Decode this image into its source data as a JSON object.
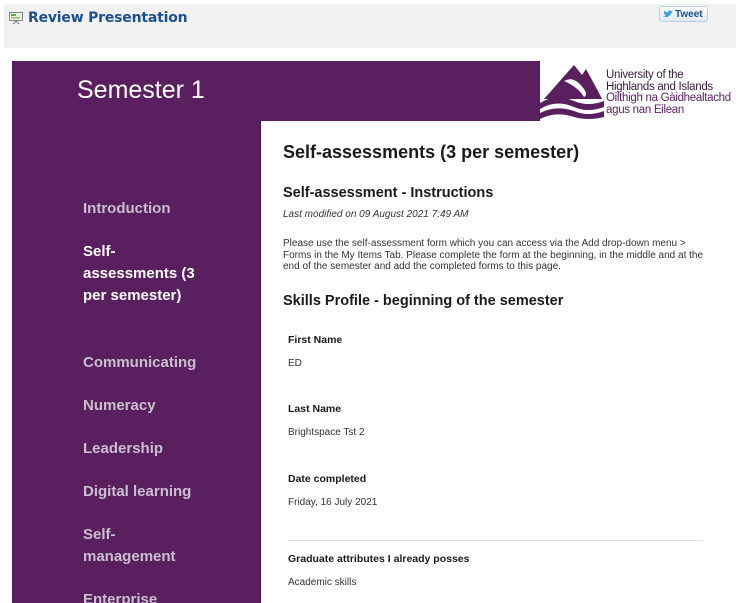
{
  "topbar": {
    "review_label": "Review Presentation",
    "review_icon": "presentation-icon",
    "tweet_label": "Tweet",
    "tweet_icon": "twitter-bird-icon"
  },
  "header": {
    "title": "Semester 1",
    "colors": {
      "brand_purple": "#5a1f5e",
      "link_blue": "#1b4f8f"
    },
    "logo": {
      "line1": "University of the",
      "line2": "Highlands and Islands",
      "line3": "Oilthigh na Gàidhealtachd",
      "line4": "agus nan Eilean"
    }
  },
  "sidebar": {
    "items": [
      {
        "label": "Introduction",
        "active": false
      },
      {
        "label": "Self-assessments (3 per semester)",
        "active": true
      },
      {
        "label": "Communicating",
        "active": false
      },
      {
        "label": "Numeracy",
        "active": false
      },
      {
        "label": "Leadership",
        "active": false
      },
      {
        "label": "Digital learning",
        "active": false
      },
      {
        "label": "Self-management",
        "active": false
      },
      {
        "label": "Enterprise",
        "active": false
      }
    ]
  },
  "main": {
    "page_title": "Self-assessments (3 per semester)",
    "section_title": "Self-assessment - Instructions",
    "last_modified": "Last modified on 09 August 2021 7:49 AM",
    "instructions": "Please use the self-assessment form which you can access via the Add drop-down menu > Forms in the My Items Tab. Please complete the form at the beginning, in the middle and at the end of the semester and add the completed forms to this page.",
    "form_title": "Skills Profile - beginning of the semester",
    "fields": [
      {
        "label": "First Name",
        "value": "ED"
      },
      {
        "label": "Last Name",
        "value": "Brightspace Tst 2"
      },
      {
        "label": "Date completed",
        "value": "Friday, 16 July 2021"
      },
      {
        "label": "Graduate attributes I already posses",
        "value": "Academic skills"
      }
    ]
  }
}
